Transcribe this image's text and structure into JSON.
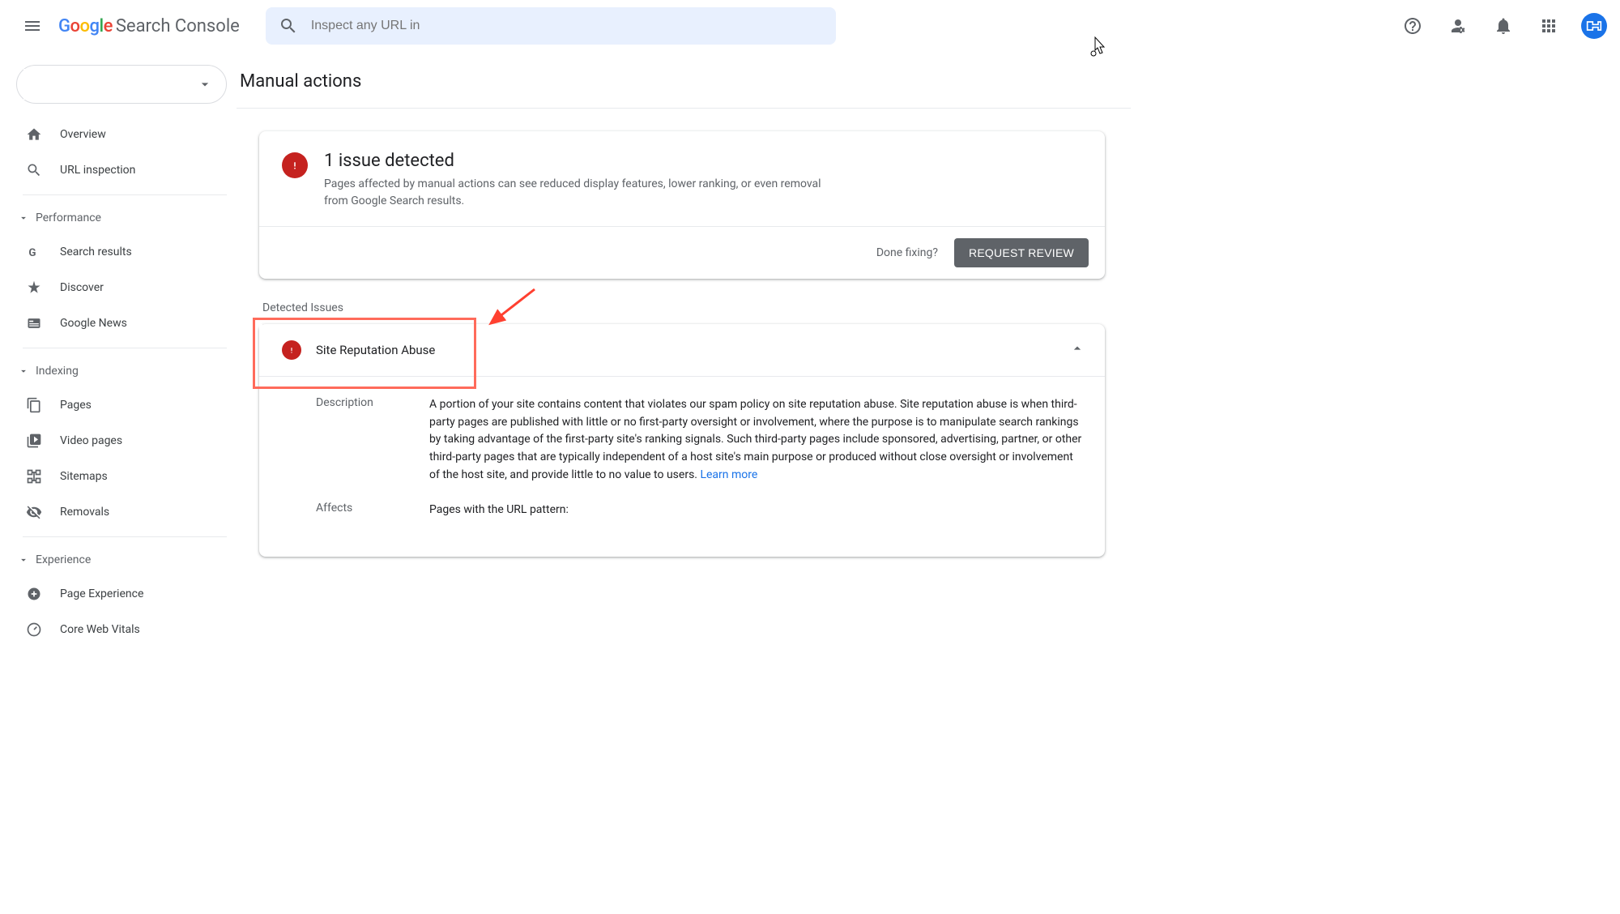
{
  "header": {
    "product_name": "Search Console",
    "search_placeholder": "Inspect any URL in "
  },
  "sidebar": {
    "items_top": [
      {
        "label": "Overview",
        "icon": "home"
      },
      {
        "label": "URL inspection",
        "icon": "search"
      }
    ],
    "section_performance": "Performance",
    "items_perf": [
      {
        "label": "Search results",
        "icon": "g"
      },
      {
        "label": "Discover",
        "icon": "star"
      },
      {
        "label": "Google News",
        "icon": "news"
      }
    ],
    "section_indexing": "Indexing",
    "items_index": [
      {
        "label": "Pages",
        "icon": "pages"
      },
      {
        "label": "Video pages",
        "icon": "video"
      },
      {
        "label": "Sitemaps",
        "icon": "sitemap"
      },
      {
        "label": "Removals",
        "icon": "removal"
      }
    ],
    "section_experience": "Experience",
    "items_exp": [
      {
        "label": "Page Experience",
        "icon": "plus-circle"
      },
      {
        "label": "Core Web Vitals",
        "icon": "gauge"
      }
    ]
  },
  "main": {
    "page_title": "Manual actions",
    "issue_count_title": "1 issue detected",
    "issue_subtitle": "Pages affected by manual actions can see reduced display features, lower ranking, or even removal from Google Search results.",
    "done_fixing": "Done fixing?",
    "request_review": "REQUEST REVIEW",
    "detected_issues_label": "Detected Issues",
    "issue": {
      "title": "Site Reputation Abuse",
      "desc_label": "Description",
      "desc_text": "A portion of your site contains content that violates our spam policy on site reputation abuse. Site reputation abuse is when third-party pages are published with little or no first-party oversight or involvement, where the purpose is to manipulate search rankings by taking advantage of the first-party site's ranking signals. Such third-party pages include sponsored, advertising, partner, or other third-party pages that are typically independent of a host site's main purpose or produced without close oversight or involvement of the host site, and provide little to no value to users. ",
      "learn_more": "Learn more",
      "affects_label": "Affects",
      "affects_text": "Pages with the URL pattern:"
    }
  }
}
